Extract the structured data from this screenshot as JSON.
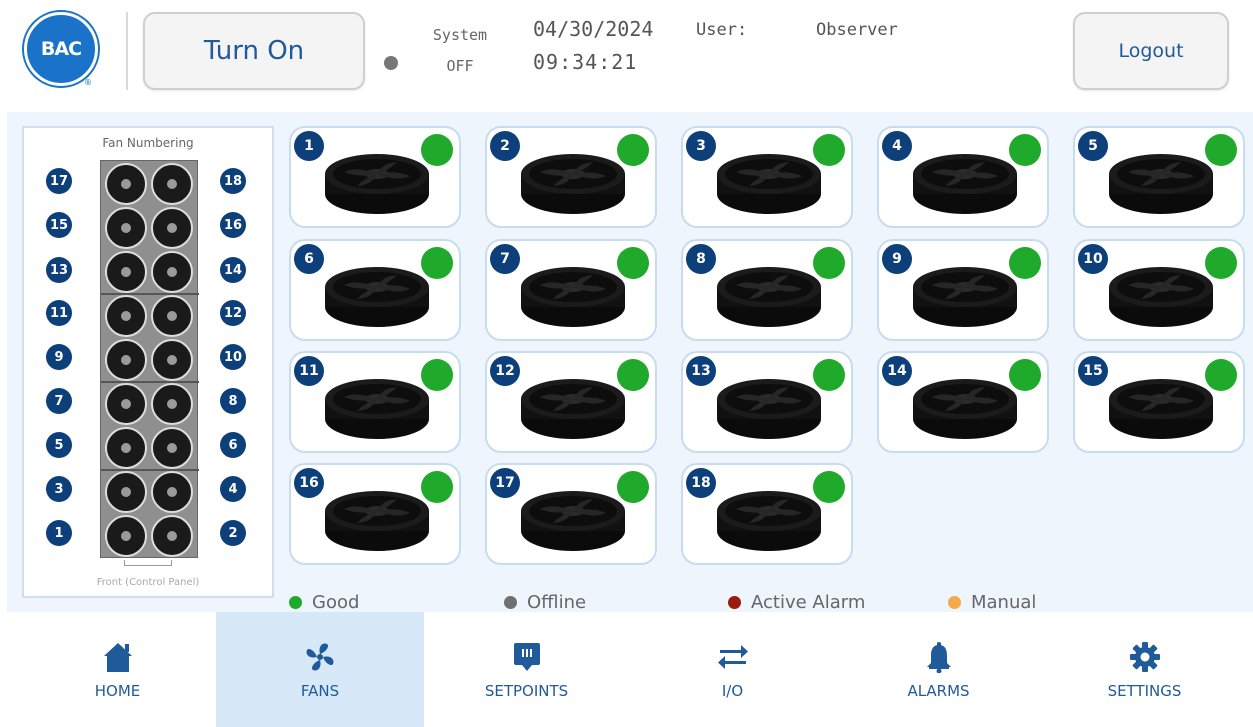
{
  "header": {
    "logo_text": "BAC",
    "logo_reg": "®",
    "turn_on_label": "Turn On",
    "system_label": "System",
    "system_state": "OFF",
    "date": "04/30/2024",
    "time": "09:34:21",
    "user_label": "User:",
    "user_value": "Observer",
    "logout_label": "Logout"
  },
  "fan_numbering": {
    "title": "Fan Numbering",
    "footer": "Front (Control Panel)",
    "left_numbers": [
      "17",
      "15",
      "13",
      "11",
      "9",
      "7",
      "5",
      "3",
      "1"
    ],
    "right_numbers": [
      "18",
      "16",
      "14",
      "12",
      "10",
      "8",
      "6",
      "4",
      "2"
    ]
  },
  "fans": [
    {
      "number": "1",
      "status": "Good"
    },
    {
      "number": "2",
      "status": "Good"
    },
    {
      "number": "3",
      "status": "Good"
    },
    {
      "number": "4",
      "status": "Good"
    },
    {
      "number": "5",
      "status": "Good"
    },
    {
      "number": "6",
      "status": "Good"
    },
    {
      "number": "7",
      "status": "Good"
    },
    {
      "number": "8",
      "status": "Good"
    },
    {
      "number": "9",
      "status": "Good"
    },
    {
      "number": "10",
      "status": "Good"
    },
    {
      "number": "11",
      "status": "Good"
    },
    {
      "number": "12",
      "status": "Good"
    },
    {
      "number": "13",
      "status": "Good"
    },
    {
      "number": "14",
      "status": "Good"
    },
    {
      "number": "15",
      "status": "Good"
    },
    {
      "number": "16",
      "status": "Good"
    },
    {
      "number": "17",
      "status": "Good"
    },
    {
      "number": "18",
      "status": "Good"
    }
  ],
  "legend": [
    {
      "label": "Good",
      "color": "#1faa2c"
    },
    {
      "label": "Offline",
      "color": "#707070"
    },
    {
      "label": "Active Alarm",
      "color": "#9b1c0c"
    },
    {
      "label": "Manual",
      "color": "#f5a94a"
    }
  ],
  "nav": [
    {
      "label": "HOME",
      "icon": "home-icon",
      "active": false
    },
    {
      "label": "FANS",
      "icon": "fan-icon",
      "active": true
    },
    {
      "label": "SETPOINTS",
      "icon": "setpoints-icon",
      "active": false
    },
    {
      "label": "I/O",
      "icon": "io-arrows-icon",
      "active": false
    },
    {
      "label": "ALARMS",
      "icon": "bell-icon",
      "active": false
    },
    {
      "label": "SETTINGS",
      "icon": "gear-icon",
      "active": false
    }
  ],
  "colors": {
    "brand_blue": "#1a73c8",
    "badge_navy": "#0d3f7a",
    "good_green": "#1faa2c",
    "nav_active_bg": "#d7e9f8"
  }
}
